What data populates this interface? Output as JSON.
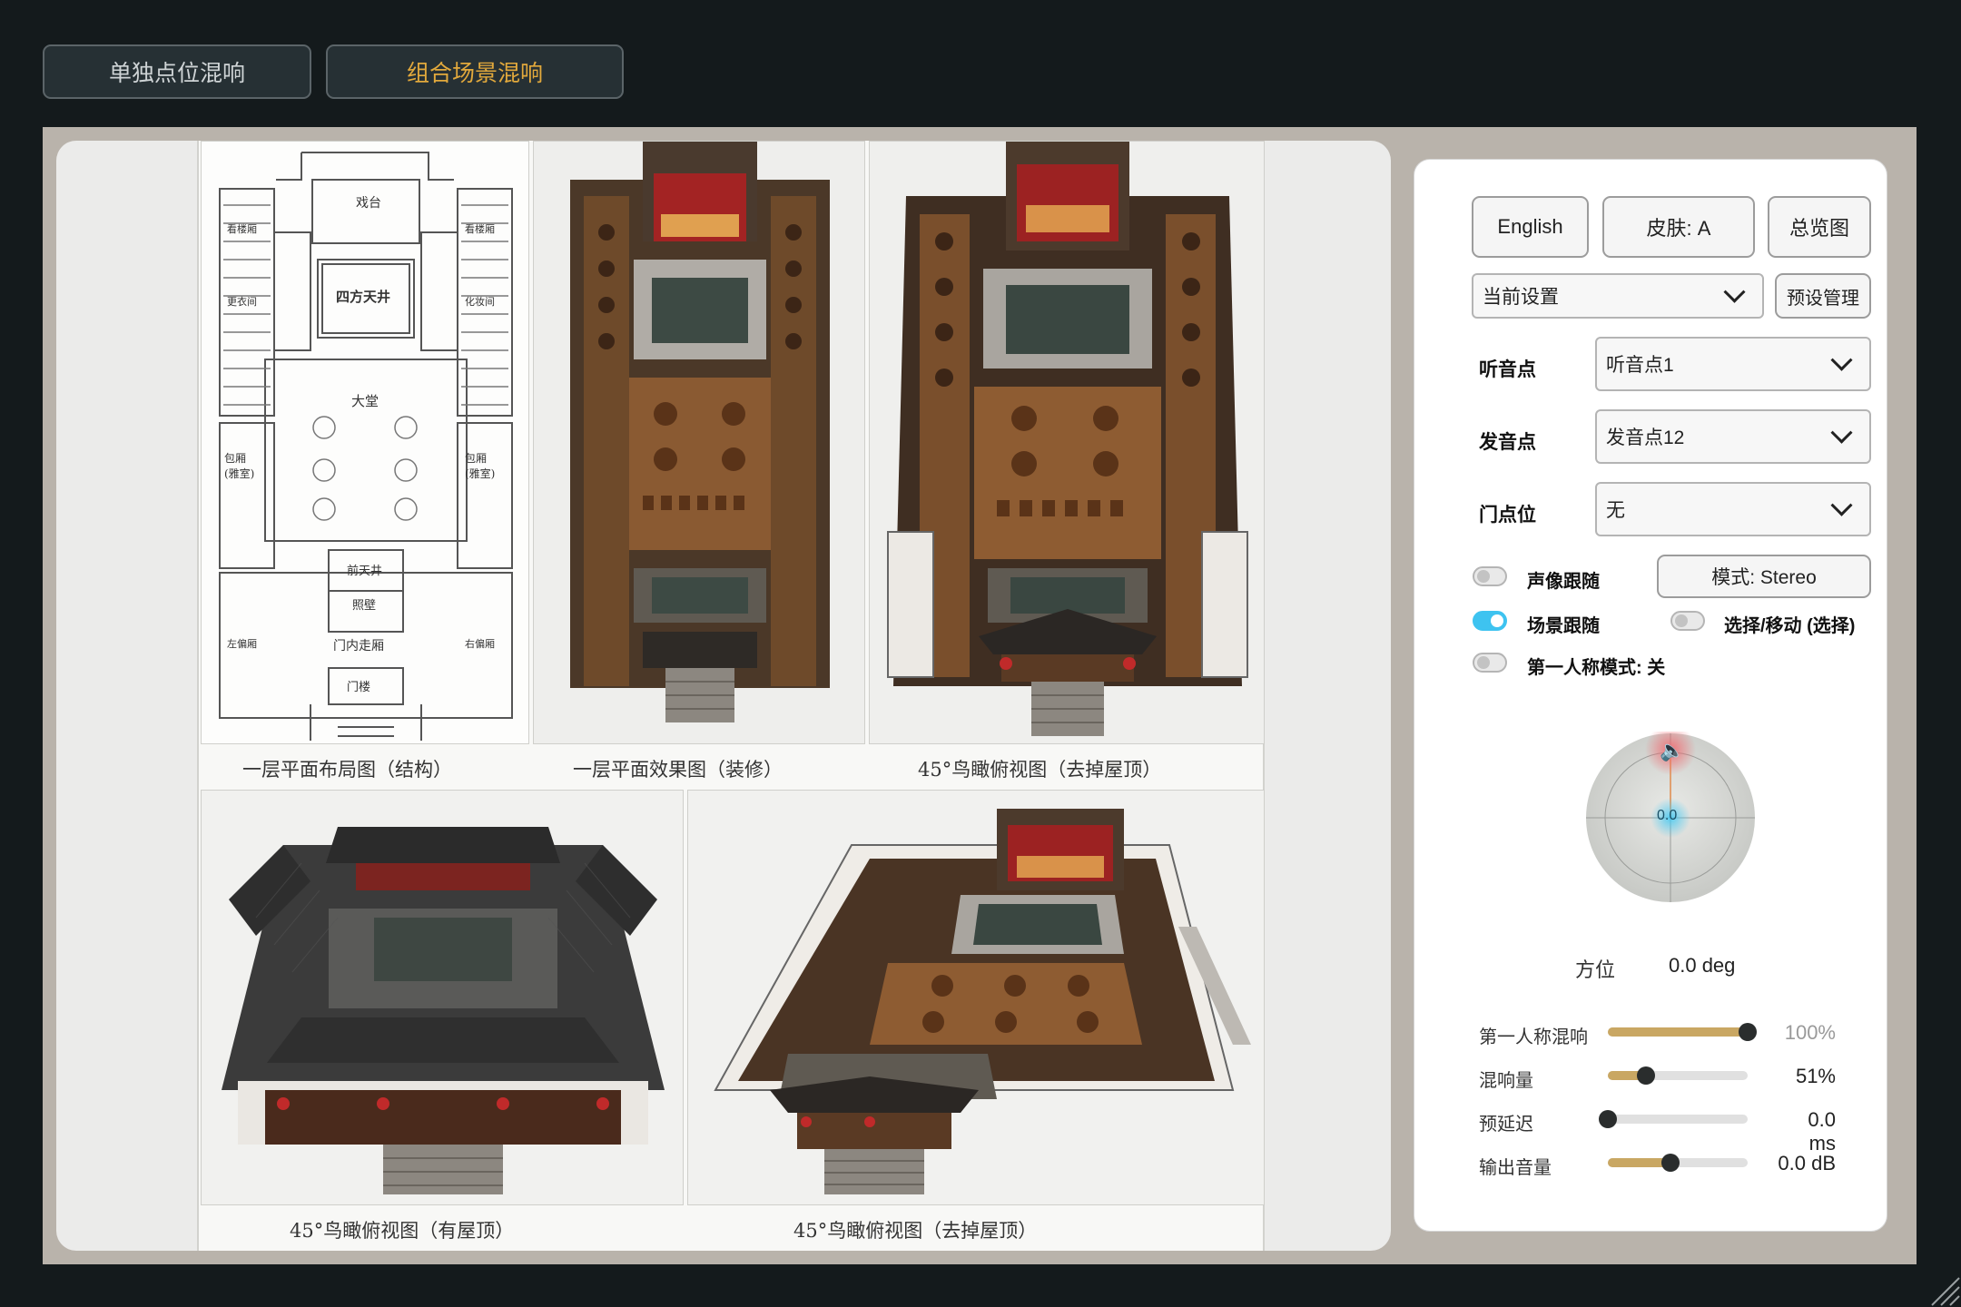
{
  "tabs": {
    "single": "单独点位混响",
    "combined": "组合场景混响"
  },
  "captions": {
    "floor_plan": "一层平面布局图（结构）",
    "floor_effect": "一层平面效果图（装修）",
    "aerial_noroof_top": "45°鸟瞰俯视图（去掉屋顶）",
    "aerial_roof": "45°鸟瞰俯视图（有屋顶）",
    "aerial_noroof_bottom": "45°鸟瞰俯视图（去掉屋顶）"
  },
  "plan_labels": {
    "stage": "戏台",
    "ring": "四方天井",
    "hall": "大堂",
    "front_well": "前天井",
    "screen": "照壁",
    "gate_hall": "门内走厢",
    "gate": "门楼",
    "left_room": "包厢\n(雅室)",
    "right_room": "包厢\n(雅室)",
    "side_rooms": [
      "看楼厢",
      "更衣间",
      "看楼厢",
      "化妆间",
      "左偏厢",
      "右偏厢"
    ]
  },
  "panel": {
    "language_button": "English",
    "skin_button": "皮肤: A",
    "overview_button": "总览图",
    "preset_select": "当前设置",
    "preset_manage_button": "预设管理",
    "listener_label": "听音点",
    "listener_value": "听音点1",
    "source_label": "发音点",
    "source_value": "发音点12",
    "door_label": "门点位",
    "door_value": "无",
    "pan_follow_label": "声像跟随",
    "pan_follow_on": false,
    "mode_button": "模式: Stereo",
    "scene_follow_label": "场景跟随",
    "scene_follow_on": true,
    "select_move_label": "选择/移动 (选择)",
    "select_move_on": false,
    "first_person_label": "第一人称模式: 关",
    "first_person_on": false,
    "dial_value": "0.0",
    "azimuth_label": "方位",
    "azimuth_value": "0.0 deg",
    "sliders": [
      {
        "label": "第一人称混响",
        "value": "100%",
        "fraction": 1.0,
        "dim": true
      },
      {
        "label": "混响量",
        "value": "51%",
        "fraction": 0.27,
        "dim": false
      },
      {
        "label": "预延迟",
        "value": "0.0 ms",
        "fraction": 0.0,
        "dim": false
      },
      {
        "label": "输出音量",
        "value": "0.0 dB",
        "fraction": 0.45,
        "dim": false
      }
    ]
  },
  "colors": {
    "accent_tab": "#e2a93c",
    "toggle_on": "#3ec3f0",
    "slider_fill": "#c9a763",
    "speaker_glow": "#f0686e",
    "listener_glow": "#48c8f0"
  }
}
